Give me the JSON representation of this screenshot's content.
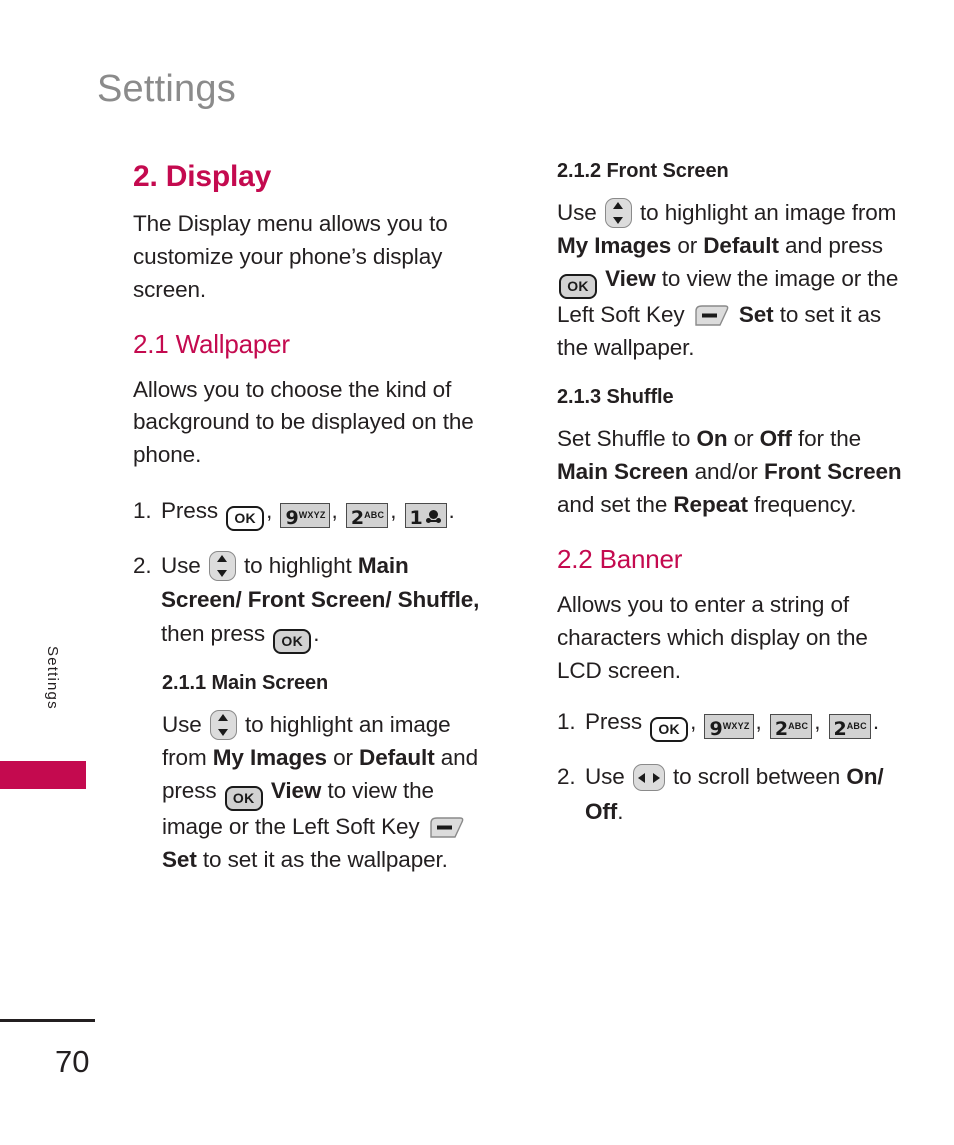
{
  "page": {
    "running_header": "Settings",
    "side_tab_label": "Settings",
    "page_number": "70",
    "accent_color": "#c40a4f",
    "header_color": "#8b8b8b",
    "body_color": "#231f20"
  },
  "icons": {
    "ok_key": "ok-key-icon",
    "nav_updown": "navigation-up-down-key-icon",
    "nav_leftright": "navigation-left-right-key-icon",
    "left_soft_key": "left-soft-key-icon",
    "key_9": "keypad-9-wxyz-icon",
    "key_2": "keypad-2-abc-icon",
    "key_1": "keypad-1-voicemail-icon"
  },
  "keys": {
    "ok": "OK",
    "nine_digit": "9",
    "nine_letters": "WXYZ",
    "two_digit": "2",
    "two_letters": "ABC",
    "one_digit": "1"
  },
  "left_column": {
    "section": {
      "title": "2. Display",
      "intro": "The Display menu allows you to customize your phone’s display screen."
    },
    "wallpaper": {
      "title": "2.1 Wallpaper",
      "intro": "Allows you to choose the kind of background to be displayed on the phone.",
      "steps": [
        {
          "marker": "1.",
          "lead": "Press",
          "trailing": "."
        },
        {
          "marker": "2.",
          "lead": "Use",
          "mid": "to highlight",
          "bold_target": "Main Screen/ Front Screen/ Shuffle,",
          "after": "then press",
          "trailing": "."
        }
      ]
    },
    "main_screen": {
      "title": "2.1.1 Main Screen",
      "t1": "Use",
      "t2": "to highlight an image from",
      "b1": "My Images",
      "t3": "or",
      "b2": "Default",
      "t4": "and press",
      "b3": "View",
      "t5": "to view the image or the Left Soft Key",
      "b4": "Set",
      "t6": "to set it as the wallpaper."
    }
  },
  "right_column": {
    "front_screen": {
      "title": "2.1.2 Front Screen",
      "t1": "Use",
      "t2": "to highlight an image from",
      "b1": "My Images",
      "t3": "or",
      "b2": "Default",
      "t4": "and press",
      "b3": "View",
      "t5": "to view the image or the Left Soft Key",
      "b4": "Set",
      "t6": "to set it as the wallpaper."
    },
    "shuffle": {
      "title": "2.1.3 Shuffle",
      "t1": "Set Shuffle to",
      "b1": "On",
      "t2": "or",
      "b2": "Off",
      "t3": "for the",
      "b3": "Main Screen",
      "t4": "and/or",
      "b4": "Front Screen",
      "t5": "and set the",
      "b5": "Repeat",
      "t6": "frequency."
    },
    "banner": {
      "title": "2.2 Banner",
      "intro": "Allows you to enter a string of characters which display on the LCD screen.",
      "steps": [
        {
          "marker": "1.",
          "lead": "Press",
          "trailing": "."
        },
        {
          "marker": "2.",
          "lead": "Use",
          "mid": "to scroll between",
          "bold_target": "On/ Off",
          "trailing": "."
        }
      ]
    }
  }
}
